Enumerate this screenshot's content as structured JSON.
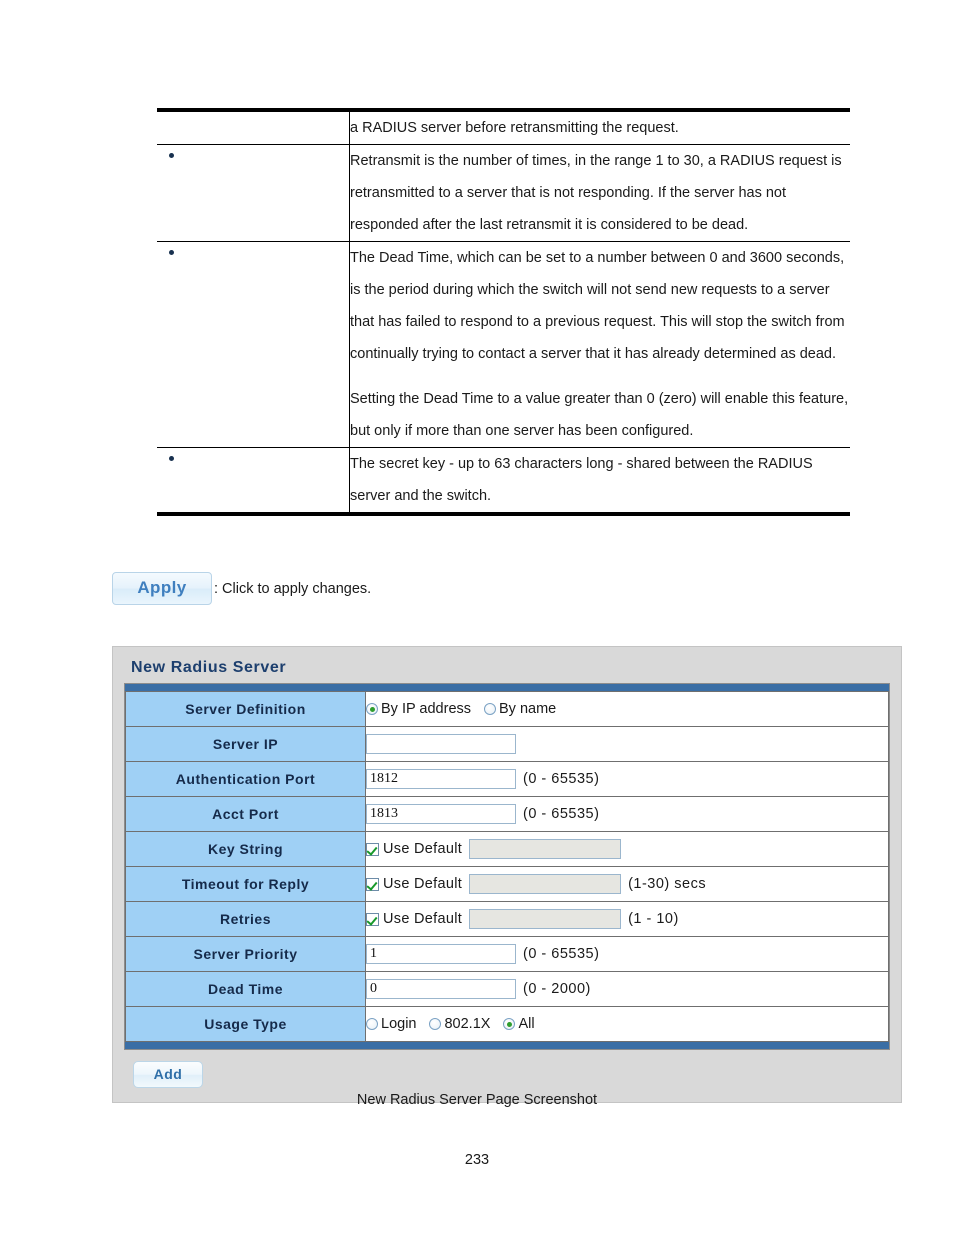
{
  "doc": {
    "page_number": "233",
    "figure_caption": "New Radius Server Page Screenshot"
  },
  "desc_table": {
    "rows": [
      {
        "bullet": false,
        "paragraphs": [
          "a RADIUS server before retransmitting the request."
        ]
      },
      {
        "bullet": true,
        "paragraphs": [
          "Retransmit is the number of times, in the range 1 to 30, a RADIUS request is retransmitted to a server that is not responding. If the server has not responded after the last retransmit it is considered to be dead."
        ]
      },
      {
        "bullet": true,
        "paragraphs": [
          "The Dead Time, which can be set to a number between 0 and 3600 seconds, is the period during which the switch will not send new requests to a server that has failed to respond to a previous request. This will stop the switch from continually trying to contact a server that it has already determined as dead.",
          "Setting the Dead Time to a value greater than 0 (zero) will enable this feature, but only if more than one server has been configured."
        ]
      },
      {
        "bullet": true,
        "paragraphs": [
          "The secret key - up to 63 characters long - shared between the RADIUS server and the switch."
        ]
      }
    ]
  },
  "apply_legend": {
    "button_label": "Apply",
    "caption": ": Click to apply changes."
  },
  "panel": {
    "title": "New Radius Server",
    "add_button_label": "Add",
    "rows": {
      "server_definition": {
        "label": "Server Definition",
        "options": [
          {
            "label": "By IP address",
            "selected": true
          },
          {
            "label": "By name",
            "selected": false
          }
        ]
      },
      "server_ip": {
        "label": "Server IP",
        "value": "",
        "hint": ""
      },
      "authentication_port": {
        "label": "Authentication Port",
        "value": "1812",
        "hint": "(0 - 65535)"
      },
      "acct_port": {
        "label": "Acct Port",
        "value": "1813",
        "hint": "(0 - 65535)"
      },
      "key_string": {
        "label": "Key String",
        "use_default_label": "Use Default",
        "use_default_checked": true,
        "value": "",
        "hint": ""
      },
      "timeout_for_reply": {
        "label": "Timeout for Reply",
        "use_default_label": "Use Default",
        "use_default_checked": true,
        "value": "",
        "hint": "(1-30) secs"
      },
      "retries": {
        "label": "Retries",
        "use_default_label": "Use Default",
        "use_default_checked": true,
        "value": "",
        "hint": "(1 - 10)"
      },
      "server_priority": {
        "label": "Server Priority",
        "value": "1",
        "hint": "(0 - 65535)"
      },
      "dead_time": {
        "label": "Dead Time",
        "value": "0",
        "hint": "(0 - 2000)"
      },
      "usage_type": {
        "label": "Usage Type",
        "options": [
          {
            "label": "Login",
            "selected": false
          },
          {
            "label": "802.1X",
            "selected": false
          },
          {
            "label": "All",
            "selected": true
          }
        ]
      }
    }
  },
  "colors": {
    "label_cell": "#9fd0f5",
    "accent_bar": "#3a6ea5",
    "panel_bg": "#d9d9d9",
    "title_text": "#1d3f6e",
    "radio_dot": "#2f9e2f",
    "check_mark": "#17992b"
  }
}
